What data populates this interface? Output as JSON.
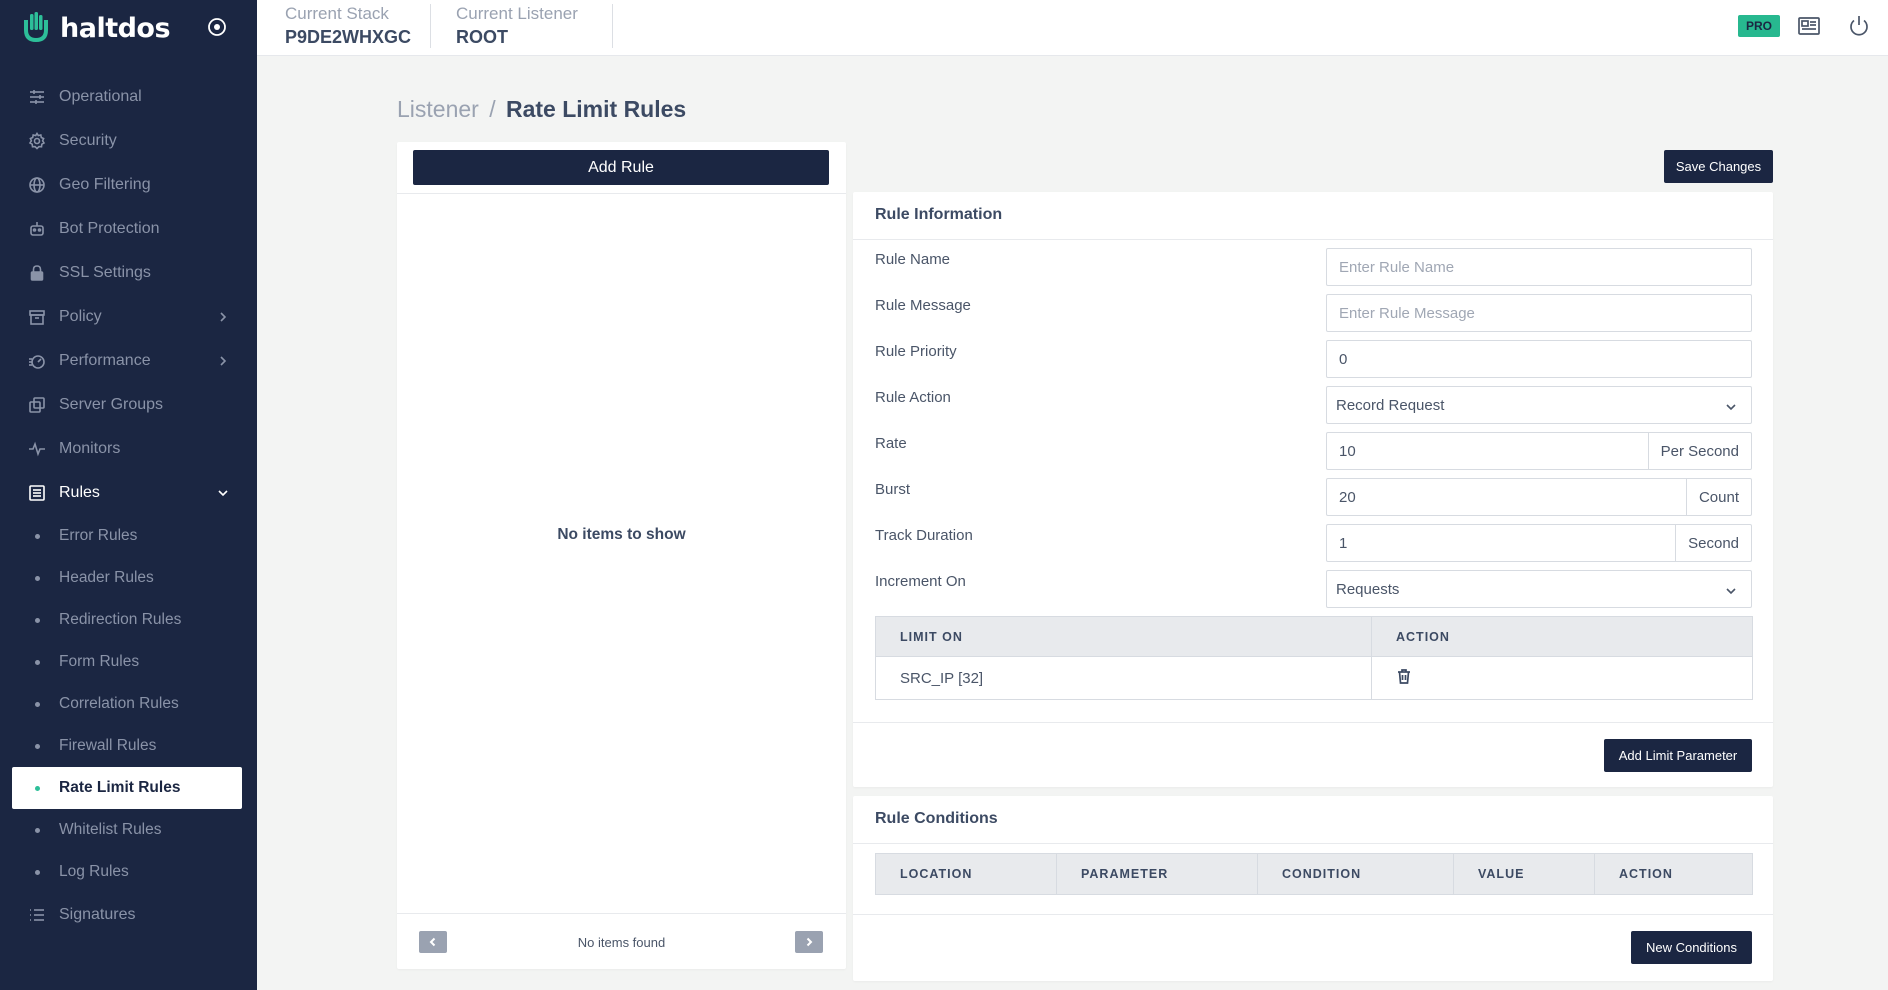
{
  "app": {
    "name": "haltdos",
    "brand_color": "#2dbf99",
    "sidebar_color": "#1b2642"
  },
  "header": {
    "stack_label": "Current Stack",
    "stack_value": "P9DE2WHXGC",
    "listener_label": "Current Listener",
    "listener_value": "ROOT",
    "pro_badge": "PRO",
    "icons": [
      "news-icon",
      "power-icon"
    ]
  },
  "sidebar": {
    "items": [
      {
        "label": "Operational",
        "icon": "sliders-icon"
      },
      {
        "label": "Security",
        "icon": "gear-icon"
      },
      {
        "label": "Geo Filtering",
        "icon": "globe-icon"
      },
      {
        "label": "Bot Protection",
        "icon": "bot-icon"
      },
      {
        "label": "SSL Settings",
        "icon": "lock-icon"
      },
      {
        "label": "Policy",
        "icon": "archive-icon"
      },
      {
        "label": "Performance",
        "icon": "performance-icon"
      },
      {
        "label": "Server Groups",
        "icon": "copy-icon"
      },
      {
        "label": "Monitors",
        "icon": "pulse-icon"
      },
      {
        "label": "Rules",
        "icon": "list-icon"
      },
      {
        "label": "Signatures",
        "icon": "signature-list-icon"
      }
    ],
    "rules_sub": [
      {
        "label": "Error Rules"
      },
      {
        "label": "Header Rules"
      },
      {
        "label": "Redirection Rules"
      },
      {
        "label": "Form Rules"
      },
      {
        "label": "Correlation Rules"
      },
      {
        "label": "Firewall Rules"
      },
      {
        "label": "Rate Limit Rules"
      },
      {
        "label": "Whitelist Rules"
      },
      {
        "label": "Log Rules"
      }
    ]
  },
  "breadcrumb": {
    "parent": "Listener",
    "separator": "/",
    "current": "Rate Limit Rules"
  },
  "list_panel": {
    "add_rule_label": "Add Rule",
    "empty_text": "No items to show",
    "pager_text": "No items found"
  },
  "actions": {
    "save_label": "Save Changes"
  },
  "rule_info": {
    "title": "Rule Information",
    "fields": {
      "name": {
        "label": "Rule Name",
        "placeholder": "Enter Rule Name"
      },
      "message": {
        "label": "Rule Message",
        "placeholder": "Enter Rule Message"
      },
      "priority": {
        "label": "Rule Priority",
        "value": "0"
      },
      "action": {
        "label": "Rule Action",
        "value": "Record Request"
      },
      "rate": {
        "label": "Rate",
        "value": "10",
        "unit": "Per Second"
      },
      "burst": {
        "label": "Burst",
        "value": "20",
        "unit": "Count"
      },
      "duration": {
        "label": "Track Duration",
        "value": "1",
        "unit": "Second"
      },
      "increment": {
        "label": "Increment On",
        "value": "Requests"
      }
    },
    "limit_table": {
      "headers": [
        "LIMIT ON",
        "ACTION"
      ],
      "rows": [
        {
          "limit_on": "SRC_IP [32]"
        }
      ]
    },
    "add_limit_label": "Add Limit Parameter"
  },
  "rule_conditions": {
    "title": "Rule Conditions",
    "headers": [
      "LOCATION",
      "PARAMETER",
      "CONDITION",
      "VALUE",
      "ACTION"
    ],
    "new_label": "New Conditions"
  }
}
